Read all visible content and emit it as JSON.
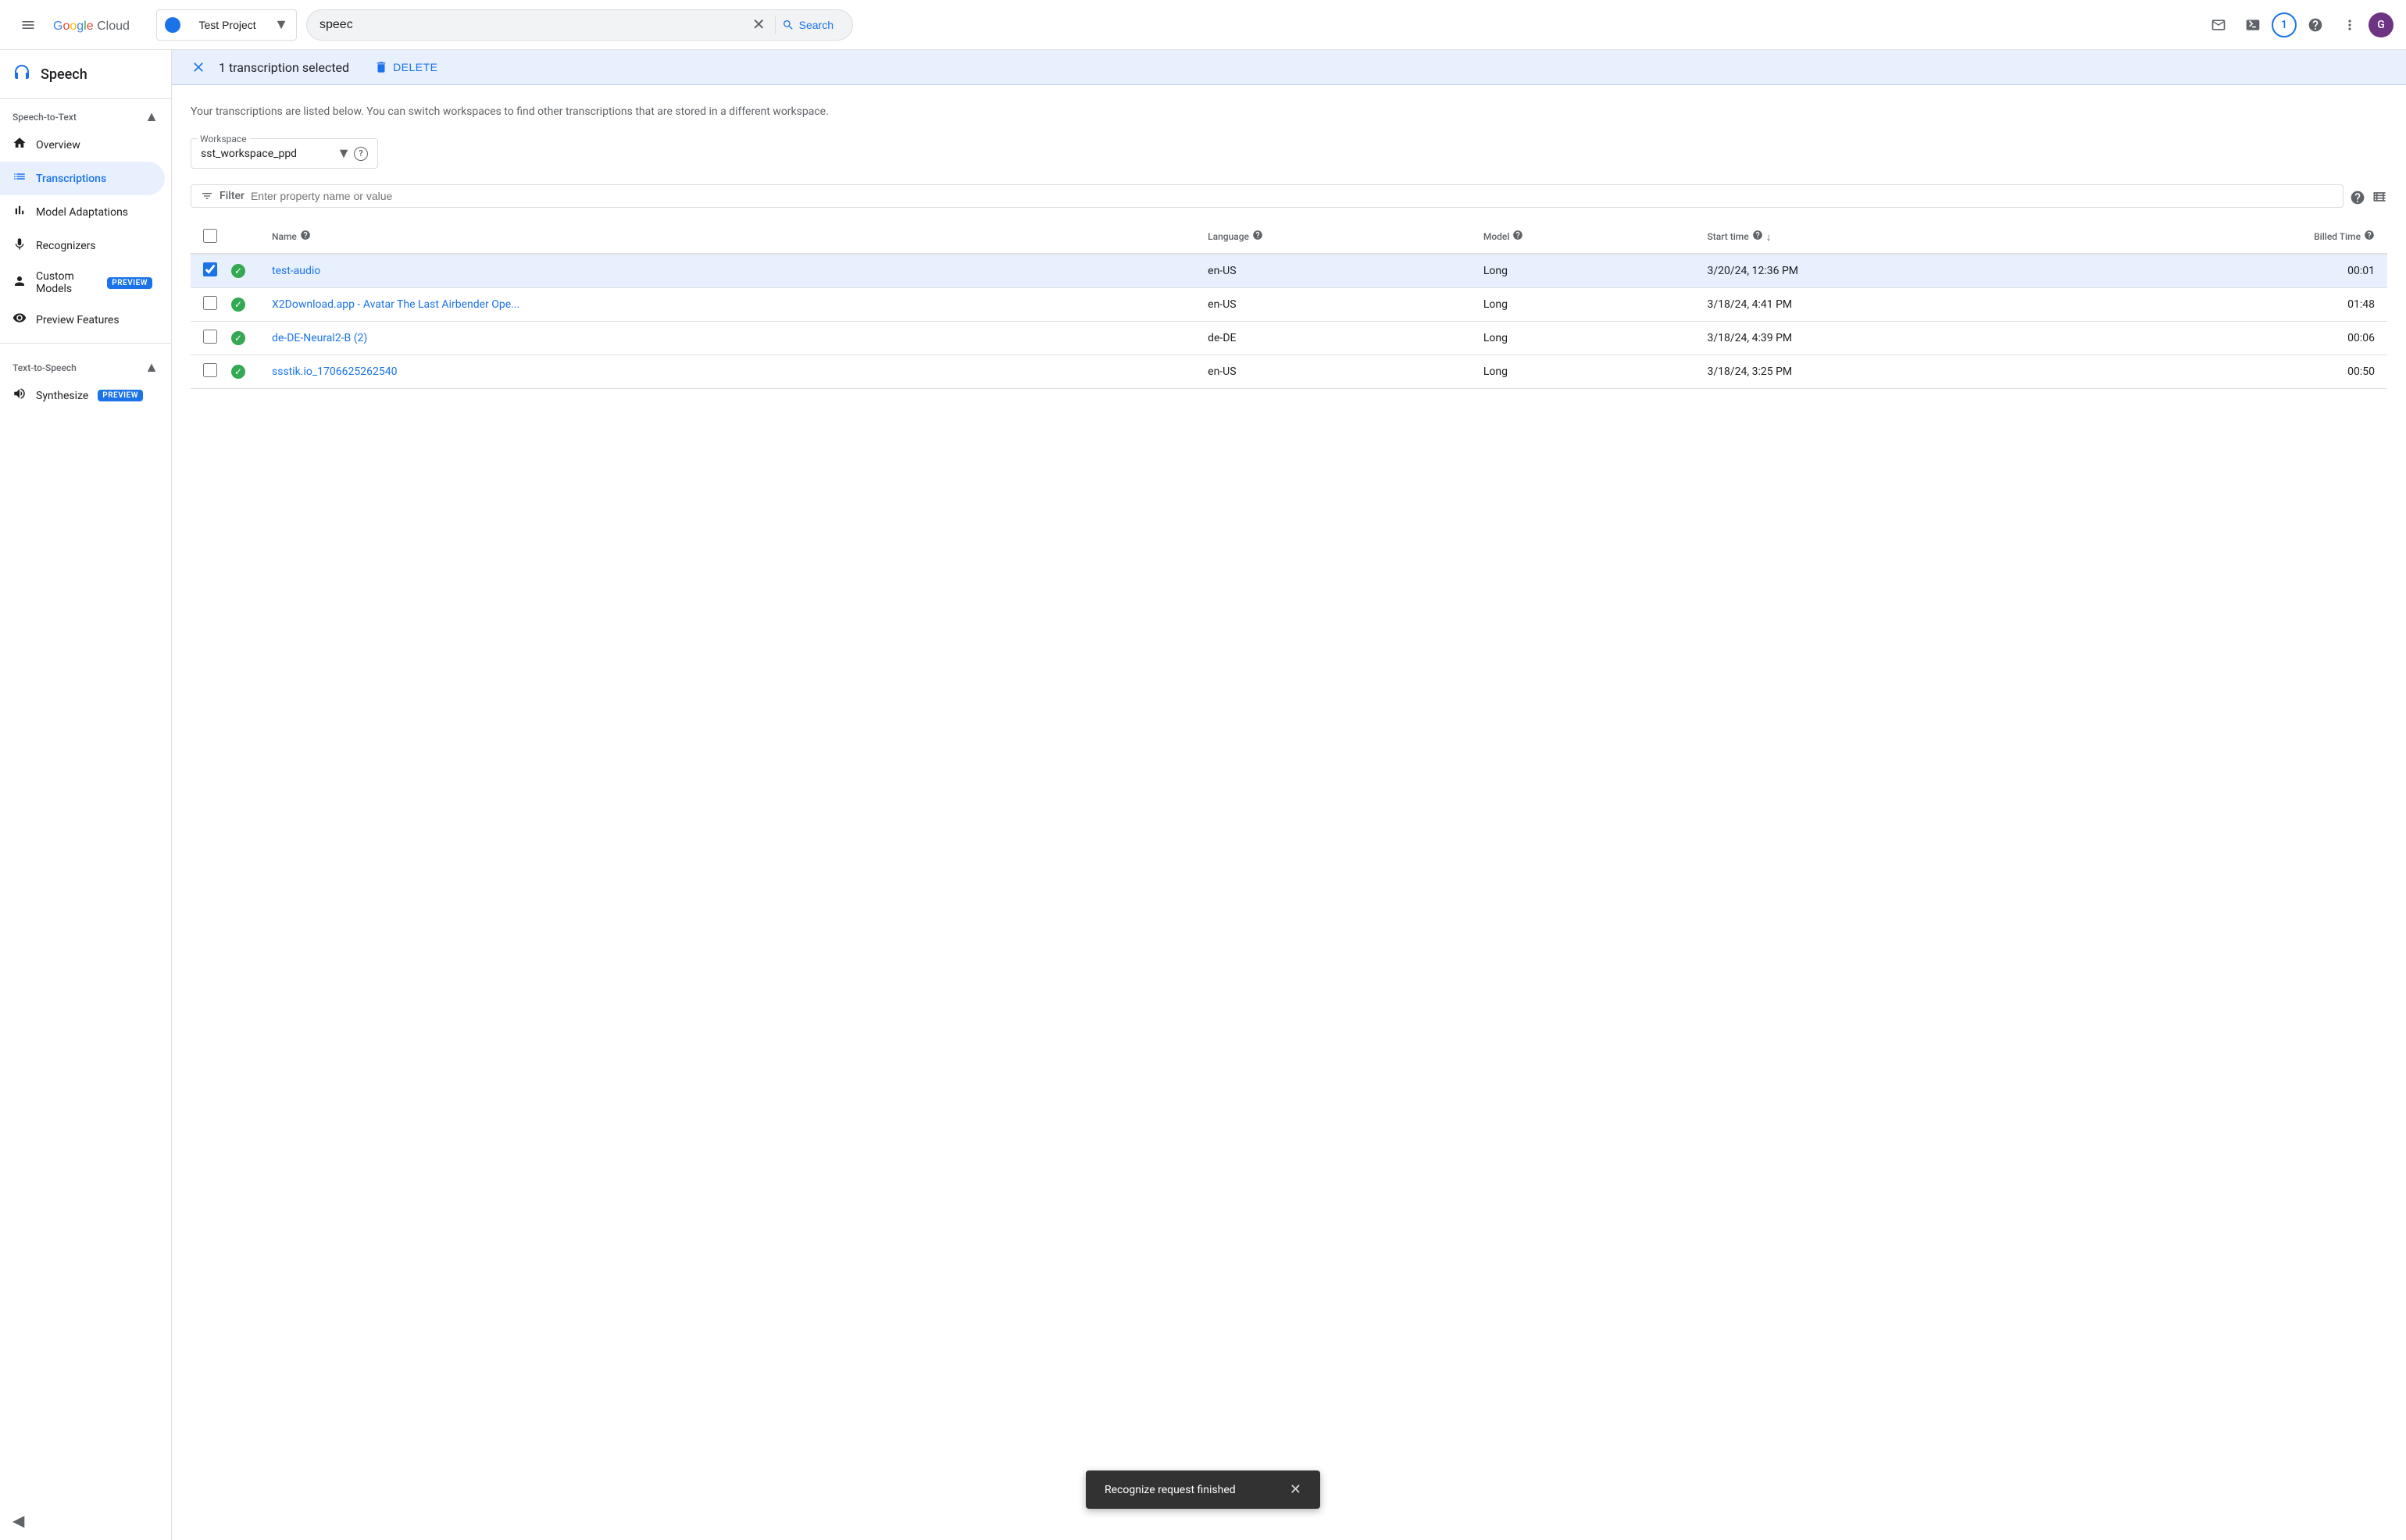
{
  "header": {
    "hamburger_label": "☰",
    "logo": {
      "google": "Google",
      "cloud": " Cloud"
    },
    "project": {
      "name": "Test Project",
      "dropdown_icon": "▼"
    },
    "search": {
      "value": "speec",
      "placeholder": "Search",
      "clear_label": "✕",
      "search_label": "Search"
    },
    "notification_count": "1",
    "avatar_letter": "G"
  },
  "sidebar": {
    "app_title": "Speech",
    "stt_section": "Speech-to-Text",
    "items": [
      {
        "id": "overview",
        "label": "Overview",
        "icon": "home"
      },
      {
        "id": "transcriptions",
        "label": "Transcriptions",
        "icon": "list",
        "active": true
      },
      {
        "id": "model-adaptations",
        "label": "Model Adaptations",
        "icon": "bar_chart"
      },
      {
        "id": "recognizers",
        "label": "Recognizers",
        "icon": "mic"
      },
      {
        "id": "custom-models",
        "label": "Custom Models",
        "icon": "person",
        "badge": "PREVIEW"
      },
      {
        "id": "preview-features",
        "label": "Preview Features",
        "icon": "visibility"
      }
    ],
    "tts_section": "Text-to-Speech",
    "tts_items": [
      {
        "id": "synthesize",
        "label": "Synthesize",
        "icon": "waves",
        "badge": "PREVIEW"
      }
    ],
    "collapse_icon": "◀"
  },
  "selection_bar": {
    "close_icon": "✕",
    "count_text": "1 transcription selected",
    "delete_icon": "🗑",
    "delete_label": "DELETE"
  },
  "content": {
    "description": "Your transcriptions are listed below. You can switch workspaces to find other transcriptions that are stored in a different workspace.",
    "workspace": {
      "label": "Workspace",
      "value": "sst_workspace_ppd",
      "dropdown_icon": "▼",
      "help_icon": "?"
    },
    "filter": {
      "icon": "filter",
      "label": "Filter",
      "placeholder": "Enter property name or value"
    },
    "table": {
      "columns": [
        {
          "id": "checkbox",
          "label": ""
        },
        {
          "id": "status",
          "label": ""
        },
        {
          "id": "name",
          "label": "Name",
          "has_help": true
        },
        {
          "id": "language",
          "label": "Language",
          "has_help": true
        },
        {
          "id": "model",
          "label": "Model",
          "has_help": true
        },
        {
          "id": "start_time",
          "label": "Start time",
          "has_help": true,
          "has_sort": true
        },
        {
          "id": "billed_time",
          "label": "Billed Time",
          "has_help": true
        }
      ],
      "rows": [
        {
          "id": "row-1",
          "selected": true,
          "status": "success",
          "name": "test-audio",
          "language": "en-US",
          "model": "Long",
          "start_time": "3/20/24, 12:36 PM",
          "billed_time": "00:01"
        },
        {
          "id": "row-2",
          "selected": false,
          "status": "success",
          "name": "X2Download.app - Avatar The Last Airbender Ope...",
          "language": "en-US",
          "model": "Long",
          "start_time": "3/18/24, 4:41 PM",
          "billed_time": "01:48"
        },
        {
          "id": "row-3",
          "selected": false,
          "status": "success",
          "name": "de-DE-Neural2-B (2)",
          "language": "de-DE",
          "model": "Long",
          "start_time": "3/18/24, 4:39 PM",
          "billed_time": "00:06"
        },
        {
          "id": "row-4",
          "selected": false,
          "status": "success",
          "name": "ssstik.io_1706625262540",
          "language": "en-US",
          "model": "Long",
          "start_time": "3/18/24, 3:25 PM",
          "billed_time": "00:50"
        }
      ]
    }
  },
  "snackbar": {
    "message": "Recognize request finished",
    "close_icon": "✕"
  }
}
